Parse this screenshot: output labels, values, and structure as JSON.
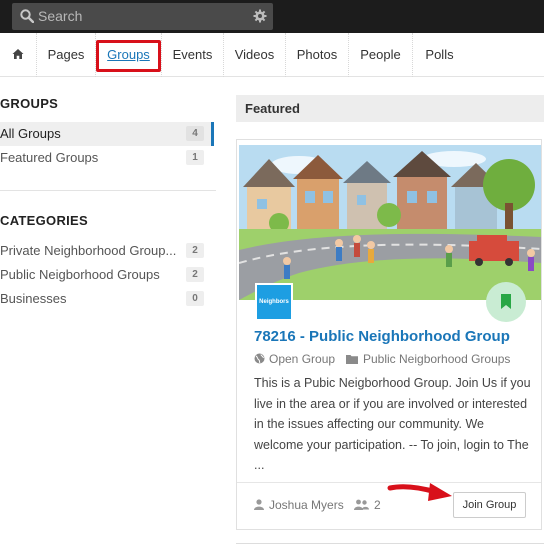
{
  "search": {
    "placeholder": "Search",
    "icon": "search-icon",
    "settings_icon": "gear-icon"
  },
  "nav": {
    "home_icon": "home-icon",
    "items": [
      {
        "label": "Pages"
      },
      {
        "label": "Groups",
        "active": true
      },
      {
        "label": "Events"
      },
      {
        "label": "Videos"
      },
      {
        "label": "Photos"
      },
      {
        "label": "People"
      },
      {
        "label": "Polls"
      }
    ]
  },
  "sidebar": {
    "groups_heading": "GROUPS",
    "groups": [
      {
        "label": "All Groups",
        "count": "4",
        "active": true
      },
      {
        "label": "Featured Groups",
        "count": "1"
      }
    ],
    "categories_heading": "CATEGORIES",
    "categories": [
      {
        "label": "Private Neighborhood Group...",
        "count": "2"
      },
      {
        "label": "Public Neigborhood Groups",
        "count": "2"
      },
      {
        "label": "Businesses",
        "count": "0"
      }
    ]
  },
  "featured": {
    "heading": "Featured",
    "card": {
      "avatar_text": "Neighbors",
      "title": "78216 - Public Neighborhood Group",
      "privacy": "Open Group",
      "category": "Public Neigborhood Groups",
      "description": "This is a Pubic Neigborhood Group. Join Us if you live in the area or if you are involved or interested in the issues affecting our community. We welcome your participation. -- To join, login to The ...",
      "author": "Joshua Myers",
      "member_count": "2",
      "join_label": "Join Group"
    }
  },
  "colors": {
    "accent": "#1a76b8",
    "highlight": "#d8101a",
    "topbar": "#1c1c1c",
    "bookmark_bg": "#c9ecd3",
    "bookmark_icon": "#28a745"
  }
}
